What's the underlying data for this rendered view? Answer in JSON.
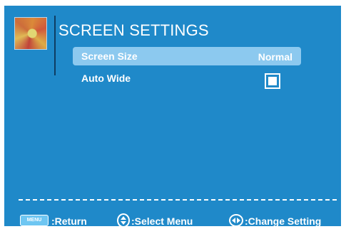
{
  "header": {
    "title": "SCREEN SETTINGS",
    "thumbnail_icon": "settings-picture-icon"
  },
  "menu": {
    "items": [
      {
        "label": "Screen Size",
        "value": "Normal",
        "selected": true
      },
      {
        "label": "Auto Wide",
        "control": "checkbox",
        "checked": false
      }
    ]
  },
  "footer": {
    "menu_key": "MENU",
    "return_label": ":Return",
    "select_label": ":Select Menu",
    "change_label": ":Change Setting"
  },
  "colors": {
    "background": "#1f89c9",
    "highlight": "#8cc9ef",
    "text": "#ffffff"
  }
}
